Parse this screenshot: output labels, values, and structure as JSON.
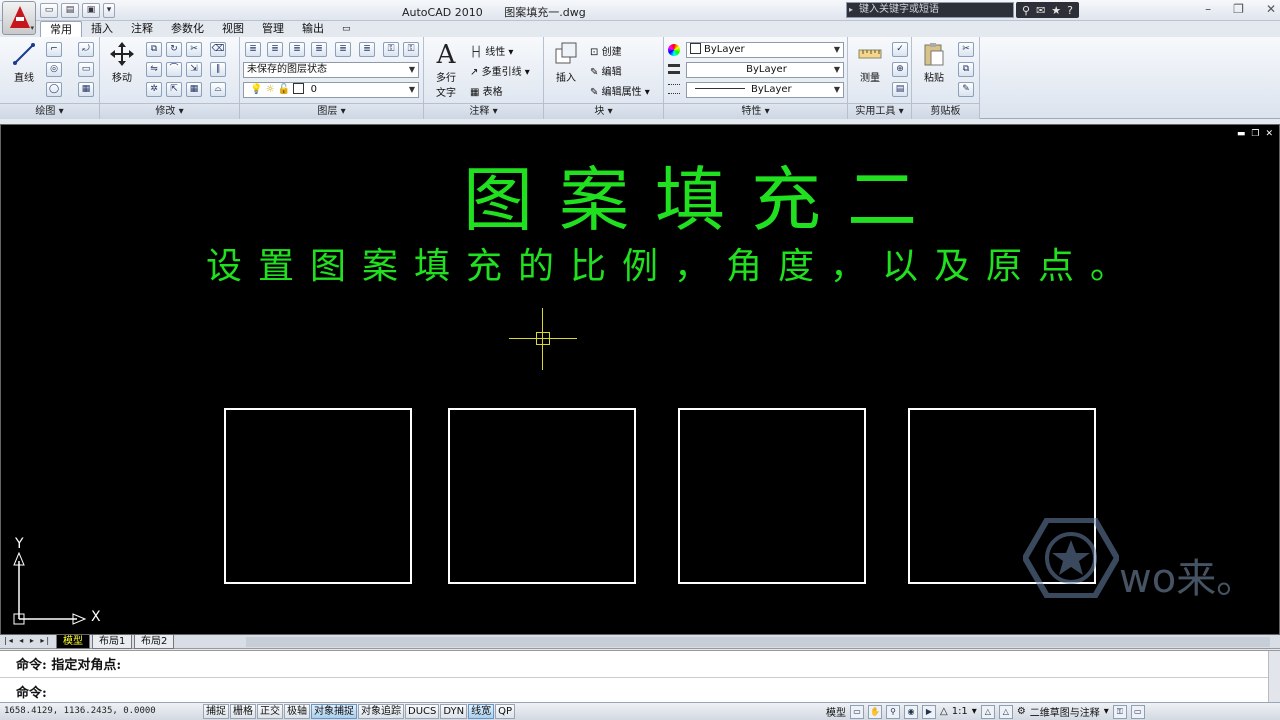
{
  "window": {
    "app_name": "AutoCAD 2010",
    "file_name": "图案填充一.dwg",
    "search_placeholder": "键入关键字或短语"
  },
  "ribbon": {
    "tabs": [
      "常用",
      "插入",
      "注释",
      "参数化",
      "视图",
      "管理",
      "输出"
    ],
    "active_tab": "常用",
    "panels": {
      "draw": {
        "title": "绘图",
        "line_label": "直线"
      },
      "modify": {
        "title": "修改",
        "move_label": "移动"
      },
      "layers": {
        "title": "图层",
        "layer_state": "未保存的图层状态",
        "current_layer": "0"
      },
      "annotation": {
        "title": "注释",
        "mtext_label": "多行\n文字",
        "mtext_l1": "多行",
        "mtext_l2": "文字",
        "linear": "线性",
        "mleader": "多重引线",
        "table": "表格"
      },
      "block": {
        "title": "块",
        "insert_label": "插入",
        "create": "创建",
        "edit": "编辑",
        "edit_attr": "编辑属性"
      },
      "properties": {
        "title": "特性",
        "color": "ByLayer",
        "linetype": "ByLayer",
        "lineweight": "ByLayer"
      },
      "utilities": {
        "title": "实用工具",
        "measure_label": "测量"
      },
      "clipboard": {
        "title": "剪贴板",
        "paste_label": "粘贴"
      }
    }
  },
  "drawing": {
    "title_text": "图案填充二",
    "subtitle_text": "设置图案填充的比例，角度，以及原点。",
    "ucs_x": "X",
    "ucs_y": "Y",
    "watermark_text": "wo来。",
    "rectangles": 4
  },
  "layout_tabs": [
    "模型",
    "布局1",
    "布局2"
  ],
  "active_layout": "模型",
  "command_line": {
    "history": "命令: 指定对角点:",
    "prompt": "命令:"
  },
  "status_bar": {
    "coordinates": "1658.4129, 1136.2435, 0.0000",
    "toggles": [
      {
        "label": "捕捉",
        "on": false
      },
      {
        "label": "栅格",
        "on": false
      },
      {
        "label": "正交",
        "on": false
      },
      {
        "label": "极轴",
        "on": false
      },
      {
        "label": "对象捕捉",
        "on": true
      },
      {
        "label": "对象追踪",
        "on": false
      },
      {
        "label": "DUCS",
        "on": false
      },
      {
        "label": "DYN",
        "on": false
      },
      {
        "label": "线宽",
        "on": true
      },
      {
        "label": "QP",
        "on": false
      }
    ],
    "model_label": "模型",
    "anno_scale": "1:1",
    "workspace": "二维草图与注释"
  }
}
